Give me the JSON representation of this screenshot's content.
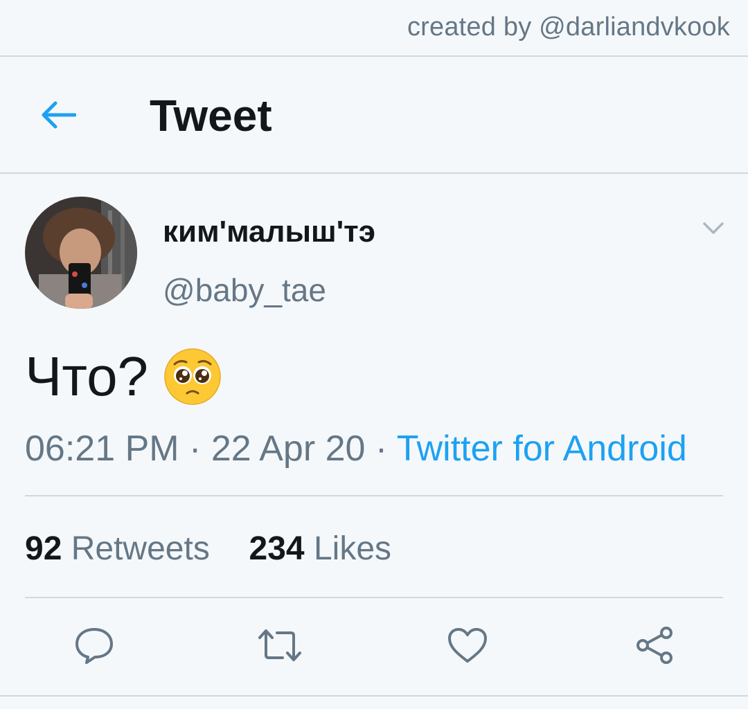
{
  "watermark": "created by @darliandvkook",
  "header": {
    "title": "Tweet"
  },
  "tweet": {
    "display_name": "ким'малыш'тэ",
    "handle": "@baby_tae",
    "text": "Что?",
    "emoji": "pleading-face",
    "time": "06:21 PM",
    "date": "22 Apr 20",
    "separator": "·",
    "source": "Twitter for Android"
  },
  "stats": {
    "retweets_count": "92",
    "retweets_label": "Retweets",
    "likes_count": "234",
    "likes_label": "Likes"
  },
  "colors": {
    "accent": "#1da1f2",
    "muted": "#657786",
    "text": "#14171a",
    "background": "#f5f8fa"
  }
}
